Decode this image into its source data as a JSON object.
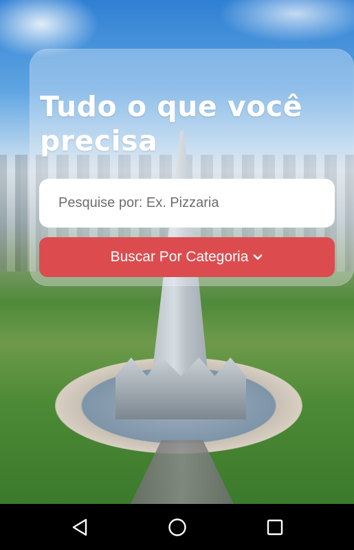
{
  "hero": {
    "headline": "Tudo o que você precisa"
  },
  "search": {
    "placeholder": "Pesquise por: Ex. Pizzaria",
    "value": ""
  },
  "category_button": {
    "label": "Buscar Por Categoria",
    "icon": "chevron-down-icon",
    "color": "#dc4c4f"
  },
  "navbar": {
    "buttons": [
      {
        "icon": "back-triangle-icon"
      },
      {
        "icon": "home-circle-icon"
      },
      {
        "icon": "recents-square-icon"
      }
    ]
  }
}
